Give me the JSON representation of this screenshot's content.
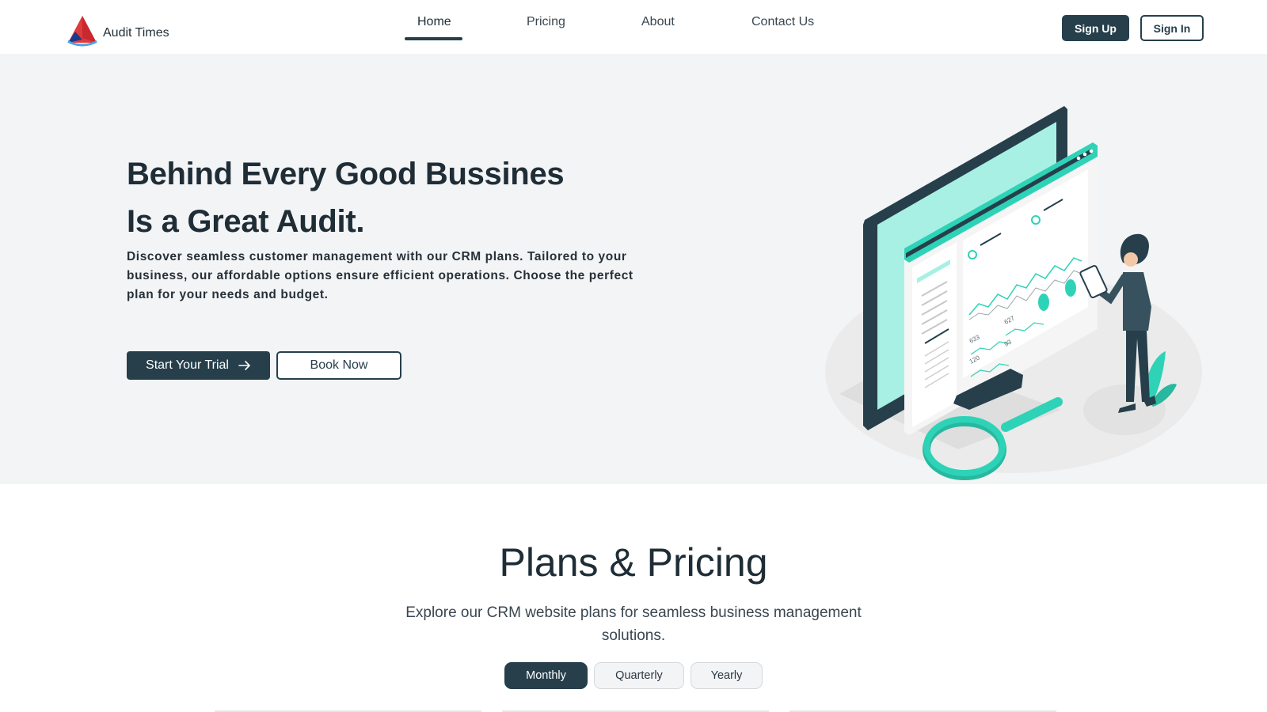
{
  "brand": {
    "name": "Audit Times",
    "logo_icon": "triangle-logo-icon"
  },
  "nav": {
    "items": [
      {
        "label": "Home",
        "active": true
      },
      {
        "label": "Pricing",
        "active": false
      },
      {
        "label": "About",
        "active": false
      },
      {
        "label": "Contact Us",
        "active": false
      }
    ],
    "signup_label": "Sign Up",
    "signin_label": "Sign In"
  },
  "hero": {
    "title_line1": "Behind Every Good Bussines",
    "title_line2": "Is a Great Audit.",
    "description": "Discover seamless customer management with our CRM plans. Tailored to your business, our affordable options ensure efficient operations. Choose the perfect plan for your needs and budget.",
    "trial_label": "Start Your Trial",
    "trial_icon": "arrow-right-icon",
    "book_label": "Book Now",
    "illustration": "analytics-dashboard-illustration",
    "chart_labels": [
      "633",
      "627",
      "120",
      "93"
    ]
  },
  "pricing": {
    "title": "Plans & Pricing",
    "subtitle": "Explore our CRM website plans for seamless business management solutions.",
    "periods": [
      {
        "label": "Monthly",
        "active": true
      },
      {
        "label": "Quarterly",
        "active": false
      },
      {
        "label": "Yearly",
        "active": false
      }
    ]
  },
  "colors": {
    "primary": "#263f4b",
    "hero_bg": "#f3f4f6",
    "accent_teal": "#2ed3b7",
    "screen_mint": "#a8f0e4",
    "logo_red": "#e03b3b",
    "logo_blue": "#3b8fe0"
  }
}
